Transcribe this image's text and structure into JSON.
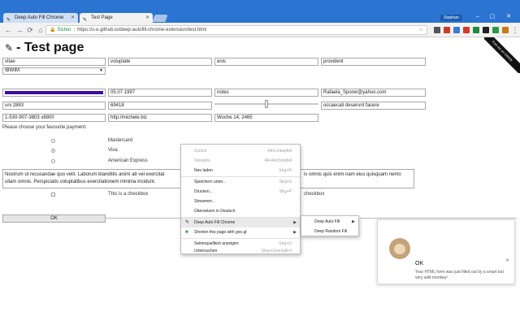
{
  "browser": {
    "tabs": [
      {
        "label": "Deep Auto Fill Chrome",
        "icon": "✎"
      },
      {
        "label": "Test Page",
        "icon": "✎"
      }
    ],
    "profile": "Stephan",
    "window_controls": {
      "minimize": "–",
      "maximize": "▢",
      "close": "✕"
    },
    "secure_label": "Sicher",
    "url": "https://s-e.github.io/deep-autofill-chrome-extension/test.html"
  },
  "page": {
    "title": "- Test page",
    "ribbon": "Fork me on GitHub",
    "fields": {
      "r1c1": "vitae",
      "r1c2": "voluptate",
      "r1c3": "enis",
      "r1c4": "provident",
      "select_value": "IBWIM",
      "date": "05.07.1997",
      "r3c3": "notes",
      "email": "Rafaela_Sporer@yahoo.com",
      "r4c1": "uni 2883",
      "r4c2": "69418",
      "r4c4": "occaecati deserunt facere",
      "phone": "1-530-907-3803 x8800",
      "url_field": "http://michele.biz",
      "week": "Woche 14, 2465"
    },
    "range_value": 0.5,
    "payment_label": "Please choose your favourite payment:",
    "payments": [
      {
        "label": "Mastercard",
        "checked": false
      },
      {
        "label": "Visa",
        "checked": true
      },
      {
        "label": "American Express",
        "checked": false
      }
    ],
    "textarea_line1": "Nostrum ut recusandae quo velit. Laborum blanditiis animi ab vel exercitat",
    "textarea_line1_end": "is omnis quis enim nam eius quisquam nemo",
    "textarea_line2": "ullam omnis. Perspiciatis voluptatibus exercitationem minima incidunt.",
    "checkbox_label": "This is a checkbox",
    "checkbox_label_2": "checkbox",
    "ok_button": "OK"
  },
  "context_menu": {
    "items": [
      {
        "label": "Zurück",
        "shortcut": "Alt+Linkspfeil",
        "disabled": true
      },
      {
        "label": "Vorwärts",
        "shortcut": "Alt+Rechtspfeil",
        "disabled": true
      },
      {
        "label": "Neu laden",
        "shortcut": "Strg+R",
        "disabled": false
      },
      {
        "label": "Speichern unter...",
        "shortcut": "Strg+S",
        "disabled": false
      },
      {
        "label": "Drucken...",
        "shortcut": "Strg+P",
        "disabled": false
      },
      {
        "label": "Streamen...",
        "shortcut": "",
        "disabled": false
      },
      {
        "label": "Übersetzen in Deutsch",
        "shortcut": "",
        "disabled": false
      },
      {
        "label": "Deep Auto Fill Chrome",
        "shortcut": "",
        "disabled": false
      },
      {
        "label": "Shorten this page with goo.gl",
        "shortcut": "",
        "disabled": false
      },
      {
        "label": "Seitenquelltext anzeigen",
        "shortcut": "Strg+U",
        "disabled": false
      },
      {
        "label": "Untersuchen",
        "shortcut": "Strg+Umschalt+I",
        "disabled": false
      }
    ],
    "submenu": [
      {
        "label": "Deep Auto Fill"
      },
      {
        "label": "Deep Random Fill"
      }
    ]
  },
  "notification": {
    "title": "OK",
    "body": "Your HTML form was just filled out by a smart but very wild monkey!",
    "close": "✕"
  }
}
